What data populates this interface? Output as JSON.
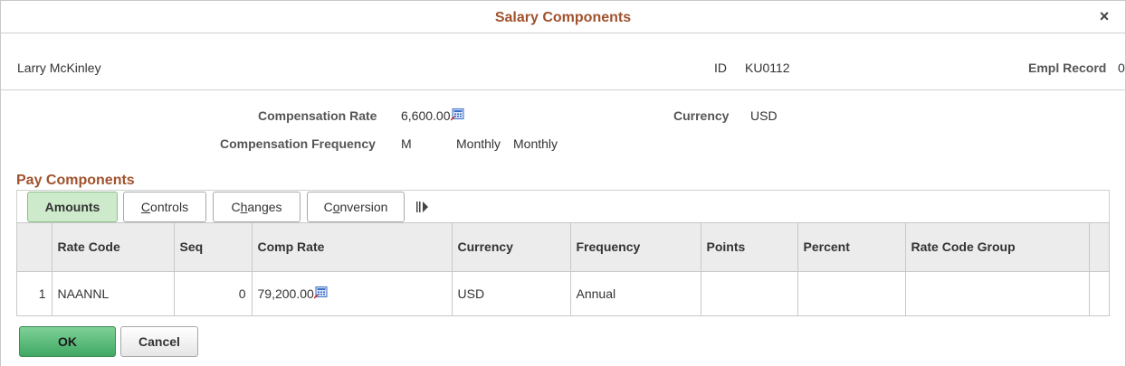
{
  "dialog": {
    "title": "Salary Components",
    "close_symbol": "×"
  },
  "employee": {
    "name": "Larry McKinley",
    "id_label": "ID",
    "id_value": "KU0112",
    "empl_record_label": "Empl Record",
    "empl_record_value": "0"
  },
  "compensation": {
    "rate_label": "Compensation Rate",
    "rate_value": "6,600.00",
    "currency_label": "Currency",
    "currency_value": "USD",
    "frequency_label": "Compensation Frequency",
    "frequency_code": "M",
    "frequency_desc1": "Monthly",
    "frequency_desc2": "Monthly"
  },
  "pay_components": {
    "title": "Pay Components",
    "tabs": [
      {
        "label": "Amounts",
        "accesskey": "",
        "rest": ""
      },
      {
        "label": "Controls",
        "accesskey": "C",
        "rest": "ontrols"
      },
      {
        "label": "Changes",
        "accesskey": "h",
        "pre": "C",
        "rest": "anges"
      },
      {
        "label": "Conversion",
        "accesskey": "o",
        "pre": "C",
        "rest": "nversion"
      }
    ],
    "columns": [
      "",
      "Rate Code",
      "Seq",
      "Comp Rate",
      "Currency",
      "Frequency",
      "Points",
      "Percent",
      "Rate Code Group",
      ""
    ],
    "rows": [
      {
        "num": "1",
        "rate_code": "NAANNL",
        "seq": "0",
        "comp_rate": "79,200.00",
        "currency": "USD",
        "frequency": "Annual",
        "points": "",
        "percent": "",
        "rate_code_group": ""
      }
    ]
  },
  "buttons": {
    "ok": "OK",
    "cancel": "Cancel"
  },
  "colors": {
    "title": "#a0522d",
    "active_tab": "#cdeacb",
    "ok_button": "#3fa863"
  },
  "icons": [
    "close-icon",
    "calculator-icon",
    "show-all-columns-icon"
  ]
}
